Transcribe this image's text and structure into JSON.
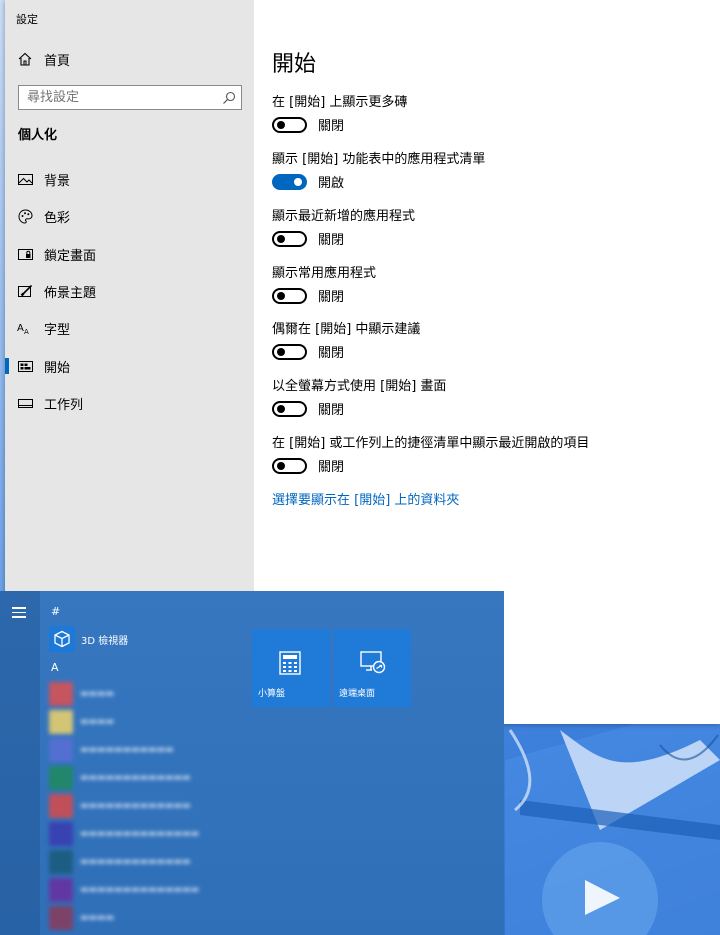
{
  "window": {
    "title": "設定"
  },
  "sidebar": {
    "home_label": "首頁",
    "search_placeholder": "尋找設定",
    "section_title": "個人化",
    "items": [
      {
        "label": "背景",
        "icon": "picture-icon"
      },
      {
        "label": "色彩",
        "icon": "palette-icon"
      },
      {
        "label": "鎖定畫面",
        "icon": "lock-screen-icon"
      },
      {
        "label": "佈景主題",
        "icon": "theme-brush-icon"
      },
      {
        "label": "字型",
        "icon": "font-icon"
      },
      {
        "label": "開始",
        "icon": "start-layout-icon",
        "selected": true
      },
      {
        "label": "工作列",
        "icon": "taskbar-icon"
      }
    ]
  },
  "content": {
    "title": "開始",
    "settings": [
      {
        "label": "在 [開始] 上顯示更多磚",
        "state": "關閉",
        "on": false
      },
      {
        "label": "顯示 [開始] 功能表中的應用程式清單",
        "state": "開啟",
        "on": true
      },
      {
        "label": "顯示最近新增的應用程式",
        "state": "關閉",
        "on": false
      },
      {
        "label": "顯示常用應用程式",
        "state": "關閉",
        "on": false
      },
      {
        "label": "偶爾在 [開始] 中顯示建議",
        "state": "關閉",
        "on": false
      },
      {
        "label": "以全螢幕方式使用 [開始] 畫面",
        "state": "關閉",
        "on": false
      },
      {
        "label": "在 [開始] 或工作列上的捷徑清單中顯示最近開啟的項目",
        "state": "關閉",
        "on": false
      }
    ],
    "link": "選擇要顯示在 [開始] 上的資料夾"
  },
  "start_menu": {
    "group_hash": "#",
    "app_3d": "3D 檢視器",
    "group_a": "A",
    "tiles": [
      {
        "label": "小算盤",
        "icon": "calculator-icon"
      },
      {
        "label": "遠端桌面",
        "icon": "remote-desktop-icon"
      }
    ],
    "colors": {
      "accent": "#0067c0",
      "tile": "#1f7ad8",
      "menu_bg": "#3677c0"
    }
  }
}
